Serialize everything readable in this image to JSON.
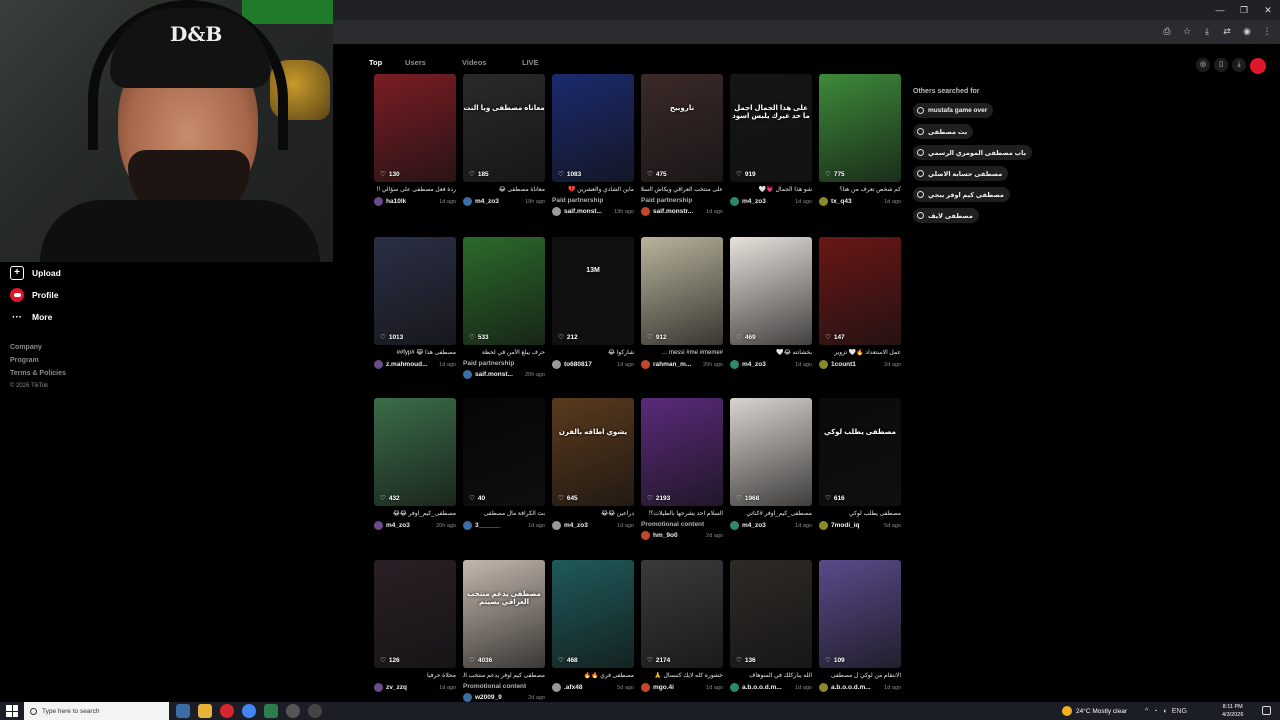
{
  "webcam": {
    "cap_text": "D&B"
  },
  "sidebar": {
    "items": [
      {
        "label": "Upload",
        "icon": "upload-icon"
      },
      {
        "label": "Profile",
        "icon": "profile-icon"
      },
      {
        "label": "More",
        "icon": "more-icon"
      }
    ],
    "links": [
      "Company",
      "Program",
      "Terms & Policies"
    ],
    "copyright": "© 2026 TikTok"
  },
  "tabs": [
    "Top",
    "Users",
    "Videos",
    "LIVE"
  ],
  "active_tab": "Top",
  "others": {
    "title": "Others searched for",
    "items": [
      "mustafa game over",
      "بث مصطفى",
      "باب مصطفى المومري الرسمي",
      "مصطفى حسابه الاصلي",
      "مصطفى كيم اوفر ببجي",
      "مصطفى لايف"
    ]
  },
  "videos": [
    {
      "likes": "130",
      "caption": "ردة فعل مصطفى على سؤالي !!",
      "user": "ha10lk",
      "ago": "1d ago",
      "tag": "",
      "overlay": "",
      "color": "#7a1d24"
    },
    {
      "likes": "185",
      "caption": "معاناة مصطفى 😂",
      "user": "m4_zo3",
      "ago": "19h ago",
      "tag": "",
      "overlay": "معاناه مصطفى ويا النت",
      "color": "#2a2a2a"
    },
    {
      "likes": "1083",
      "caption": "ماين الشادي والعشرين 💔",
      "user": "saif.monst...",
      "ago": "19h ago",
      "tag": "Paid partnership",
      "overlay": "",
      "color": "#1b2a6e"
    },
    {
      "likes": "475",
      "caption": "على منتخب العراقي ويكاش السلام",
      "user": "saif.monstr...",
      "ago": "1d ago",
      "tag": "Paid partnership",
      "overlay": "ناروبيح",
      "color": "#3b2a28"
    },
    {
      "likes": "919",
      "caption": "شو هذا الجمال 💗🤍",
      "user": "m4_zo3",
      "ago": "1d ago",
      "tag": "",
      "overlay": "على هذا الجمال اجمل ما حد غيرك يلبس اسود",
      "color": "#151515"
    },
    {
      "likes": "775",
      "caption": "كم شخص تعرف من هنا؟",
      "user": "tx_q43",
      "ago": "1d ago",
      "tag": "",
      "overlay": "",
      "color": "#3d8a3a"
    },
    {
      "likes": "1013",
      "caption": "مصطفى هذا 😹 #fyp##",
      "user": "z.mahmoud...",
      "ago": "1d ago",
      "tag": "",
      "overlay": "",
      "color": "#2b2f45"
    },
    {
      "likes": "533",
      "caption": "حرف يبلغ الأمن في لحظة",
      "user": "saif.monst...",
      "ago": "20h ago",
      "tag": "Paid partnership",
      "overlay": "",
      "color": "#2c6a2c"
    },
    {
      "likes": "212",
      "caption": "شاركوا 😂",
      "user": "to680817",
      "ago": "1d ago",
      "tag": "",
      "overlay": "13M",
      "color": "#101010"
    },
    {
      "likes": "912",
      "caption": "#messi #me #meme ...",
      "user": "rahman_m...",
      "ago": "20h ago",
      "tag": "",
      "overlay": "",
      "color": "#b9b39c"
    },
    {
      "likes": "469",
      "caption": "بخشانته 😂🤍",
      "user": "m4_zo3",
      "ago": "1d ago",
      "tag": "",
      "overlay": "",
      "color": "#e8e1dc"
    },
    {
      "likes": "147",
      "caption": "عمل الاستعداد 🔥🤍 تزوير",
      "user": "1count1",
      "ago": "2d ago",
      "tag": "",
      "overlay": "",
      "color": "#6a1616"
    },
    {
      "likes": "432",
      "caption": "مصطفى_كيم_اوفر 😂😂",
      "user": "m4_zo3",
      "ago": "20h ago",
      "tag": "",
      "overlay": "",
      "color": "#3b6d48"
    },
    {
      "likes": "40",
      "caption": "بث الكرافة مال مصطفى",
      "user": "3______",
      "ago": "1d ago",
      "tag": "",
      "overlay": "",
      "color": "#060606"
    },
    {
      "likes": "645",
      "caption": "دراعين 😂😂",
      "user": "m4_zo3",
      "ago": "1d ago",
      "tag": "",
      "overlay": "يشوي اطاقه بالفرن",
      "color": "#5a3a1d"
    },
    {
      "likes": "2193",
      "caption": "السلام احد يشرحها بالطيلات؟!",
      "user": "hm_9o0",
      "ago": "2d ago",
      "tag": "Promotional content",
      "overlay": "",
      "color": "#5a2a7a"
    },
    {
      "likes": "1968",
      "caption": "مصطفى_كيم_اوفر #كناتي",
      "user": "m4_zo3",
      "ago": "1d ago",
      "tag": "",
      "overlay": "",
      "color": "#d9d4cf"
    },
    {
      "likes": "616",
      "caption": "مصطفى يطلب لوكي",
      "user": "7modi_iq",
      "ago": "5d ago",
      "tag": "",
      "overlay": "مصطفى يطلب لوكي",
      "color": "#0a0a0a"
    },
    {
      "likes": "126",
      "caption": "محلاة حرفيا",
      "user": "zv_zzq",
      "ago": "1d ago",
      "tag": "",
      "overlay": "",
      "color": "#2a1f26"
    },
    {
      "likes": "4036",
      "caption": "مصطفى كيم اوفر يدعم منتخب العراقي",
      "user": "w2009_9",
      "ago": "2d ago",
      "tag": "Promotional content",
      "overlay": "مصطفى يدعم منتخب العراقي بصيتم",
      "color": "#c4b7ad"
    },
    {
      "likes": "468",
      "caption": "مصطفى فري 🔥🔥",
      "user": ".afx48",
      "ago": "5d ago",
      "tag": "",
      "overlay": "",
      "color": "#1f5a5a"
    },
    {
      "likes": "2174",
      "caption": "خشوره كله لايك كتبسال 🙏",
      "user": "mgo.4i",
      "ago": "1d ago",
      "tag": "",
      "overlay": "",
      "color": "#3a3a3a"
    },
    {
      "likes": "136",
      "caption": "الله يباركلك في السوهاف",
      "user": "a.b.o.o.d.m...",
      "ago": "1d ago",
      "tag": "",
      "overlay": "",
      "color": "#2e2a26"
    },
    {
      "likes": "109",
      "caption": "الانتقام من لوكي ل مصطفى",
      "user": "a.b.o.o.d.m...",
      "ago": "1d ago",
      "tag": "",
      "overlay": "",
      "color": "#5a4a8a"
    }
  ],
  "taskbar": {
    "search_placeholder": "Type here to search",
    "weather": "24°C  Mostly clear",
    "lang": "ENG",
    "time": "8:11 PM",
    "date": "4/3/2026"
  }
}
